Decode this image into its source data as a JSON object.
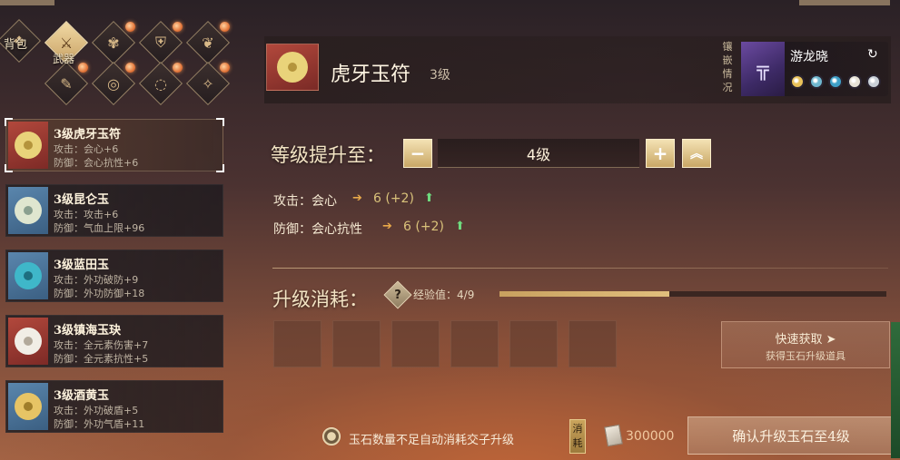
{
  "categories": {
    "tabs": [
      {
        "label": "背包",
        "icon": "backpack-icon",
        "glyph": "❖",
        "active": false
      },
      {
        "label": "武器",
        "icon": "weapon-icon",
        "glyph": "⚔",
        "active": true
      },
      {
        "label": "",
        "icon": "lotus-icon",
        "glyph": "✾",
        "active": false
      },
      {
        "label": "",
        "icon": "armor-icon",
        "glyph": "⛨",
        "active": false
      },
      {
        "label": "",
        "icon": "boots-icon",
        "glyph": "❦",
        "active": false
      },
      {
        "label": "",
        "icon": "feather-icon",
        "glyph": "✎",
        "active": false
      },
      {
        "label": "",
        "icon": "ring-icon",
        "glyph": "◎",
        "active": false
      },
      {
        "label": "",
        "icon": "bracelet-icon",
        "glyph": "◌",
        "active": false
      },
      {
        "label": "",
        "icon": "necklace-icon",
        "glyph": "✧",
        "active": false
      }
    ]
  },
  "items": [
    {
      "name": "3级虎牙玉符",
      "line1": "攻击：会心+6",
      "line2": "防御：会心抗性+6",
      "bg": "red",
      "disc": "#e9d37a",
      "hole": "#b4943c"
    },
    {
      "name": "3级昆仑玉",
      "line1": "攻击：攻击+6",
      "line2": "防御：气血上限+96",
      "bg": "blue",
      "disc": "#dfe6cf",
      "hole": "#8aa08f"
    },
    {
      "name": "3级蓝田玉",
      "line1": "攻击：外功破防+9",
      "line2": "防御：外功防御+18",
      "bg": "blue",
      "disc": "#3fb7c9",
      "hole": "#1d6f80"
    },
    {
      "name": "3级镇海玉玦",
      "line1": "攻击：全元素伤害+7",
      "line2": "防御：全元素抗性+5",
      "bg": "red",
      "disc": "#f1eee6",
      "hole": "#b2a99a"
    },
    {
      "name": "3级酒黄玉",
      "line1": "攻击：外功破盾+5",
      "line2": "防御：外功气盾+11",
      "bg": "blue",
      "disc": "#e7c465",
      "hole": "#a07e2a"
    }
  ],
  "header": {
    "title": "虎牙玉符",
    "level": "3级",
    "inlay_label": "镶嵌情况",
    "weapon_name": "游龙晓",
    "swap_icon": "swap-icon",
    "gems": [
      "#e9c25a",
      "#6fb7cf",
      "#3ea0c8",
      "#e7e2d6",
      "#c9d0d8"
    ]
  },
  "upgrade": {
    "title": "等级提升至：",
    "target_level": "4级",
    "minus": "−",
    "plus": "+",
    "max": "︽",
    "attributes": [
      {
        "label": "攻击：会心",
        "value": "6 (+2)"
      },
      {
        "label": "防御：会心抗性",
        "value": "6 (+2)"
      }
    ]
  },
  "cost": {
    "title": "升级消耗：",
    "help": "?",
    "exp_label": "经验值：",
    "exp_value": "4/9",
    "exp_progress": 0.44,
    "slot_count": 6,
    "quick_title": "快速获取",
    "quick_sub": "获得玉石升级道具"
  },
  "footer": {
    "auto_text": "玉石数量不足自动消耗交子升级",
    "consume_tag": "消耗",
    "cost_value": "300000",
    "confirm": "确认升级玉石至4级"
  }
}
